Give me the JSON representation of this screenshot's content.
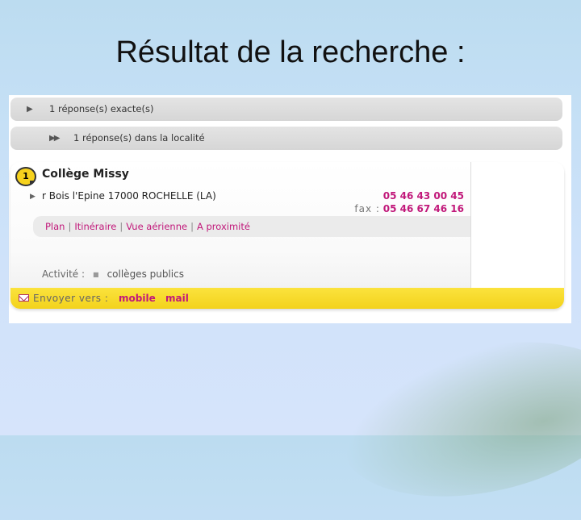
{
  "slide": {
    "title": "Résultat de la recherche :"
  },
  "results": {
    "exact": "1 réponse(s) exacte(s)",
    "locality": "1 réponse(s) dans la localité"
  },
  "entry": {
    "number": "1",
    "name": "Collège Missy",
    "address": "r Bois l'Epine 17000 ROCHELLE (LA)",
    "phone": "05 46 43 00 45",
    "fax_label": "fax :",
    "fax": "05 46 67 46 16",
    "links": [
      "Plan",
      "Itinéraire",
      "Vue aérienne",
      "A proximité"
    ],
    "activity_label": "Activité :",
    "activity_value": "collèges publics",
    "send_label": "Envoyer vers :",
    "send_mobile": "mobile",
    "send_mail": "mail"
  },
  "colors": {
    "accent": "#c1187a",
    "band": "#f6d21d"
  },
  "icons": {
    "expand": "triangle-right",
    "expand_double": "double-triangle-right",
    "mail": "envelope"
  }
}
